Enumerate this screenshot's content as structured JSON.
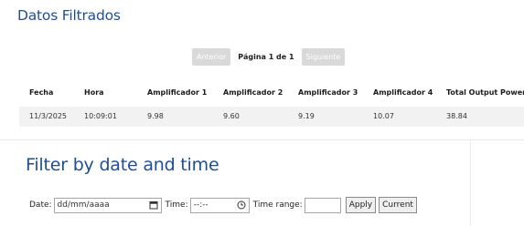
{
  "filtered": {
    "title": "Datos Filtrados",
    "pager": {
      "prev_label": "Anterior",
      "page_label": "Página 1 de 1",
      "next_label": "Siguiente"
    },
    "columns": [
      "Fecha",
      "Hora",
      "Amplificador 1",
      "Amplificador 2",
      "Amplificador 3",
      "Amplificador 4",
      "Total Output Power"
    ],
    "rows": [
      [
        "11/3/2025",
        "10:09:01",
        "9.98",
        "9.60",
        "9.19",
        "10.07",
        "38.84"
      ]
    ]
  },
  "filter": {
    "title": "Filter by date and time",
    "date_label": "Date:",
    "date_placeholder": "dd/mm/aaaa",
    "time_label": "Time:",
    "time_placeholder": "--:--",
    "range_label": "Time range:",
    "range_value": "",
    "apply_label": "Apply",
    "current_label": "Current"
  },
  "icons": {
    "date_picker": "calendar-icon",
    "time_picker": "clock-icon"
  },
  "colors": {
    "title_blue": "#1f4e99",
    "pager_button_bg": "#d9d9d9",
    "row_bg": "#f2f2f2"
  }
}
